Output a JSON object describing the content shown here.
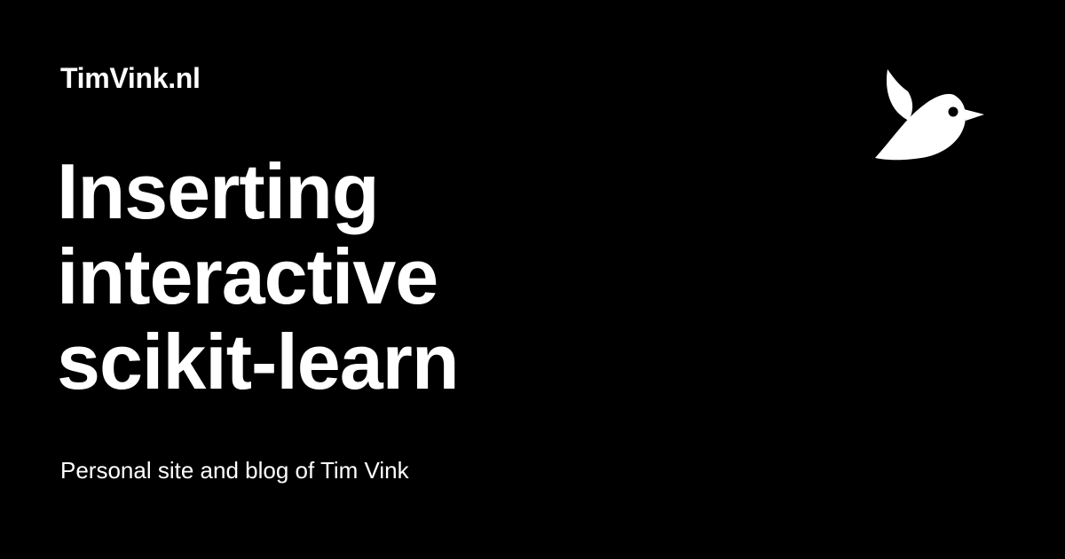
{
  "site": {
    "name": "TimVink.nl"
  },
  "post": {
    "title_lines": [
      "Inserting",
      "interactive",
      "scikit-learn"
    ]
  },
  "subtitle": "Personal site and blog of Tim Vink",
  "logo": {
    "icon": "bird-icon"
  },
  "colors": {
    "background": "#000000",
    "foreground": "#ffffff"
  }
}
